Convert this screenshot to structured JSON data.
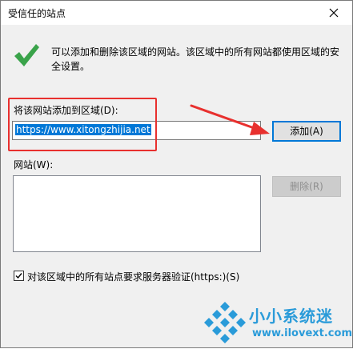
{
  "window": {
    "title": "受信任的站点"
  },
  "info": {
    "text": "可以添加和删除该区域的网站。该区域中的所有网站都使用区域的安全设置。"
  },
  "add_site": {
    "label": "将该网站添加到区域(D):",
    "value": "https://www.xitongzhijia.net",
    "button": "添加(A)"
  },
  "sites": {
    "label": "网站(W):",
    "remove_button": "删除(R)",
    "items": []
  },
  "verify": {
    "label": "对该区域中的所有站点要求服务器验证(https:)(S)",
    "checked": true
  },
  "colors": {
    "annotation_red": "#e8302e",
    "selection_blue": "#0078d7",
    "check_green": "#3aa34a",
    "watermark_blue": "#2a9bd9"
  },
  "watermark": {
    "name": "小小系统迷",
    "url": "www.ilovext.com"
  }
}
